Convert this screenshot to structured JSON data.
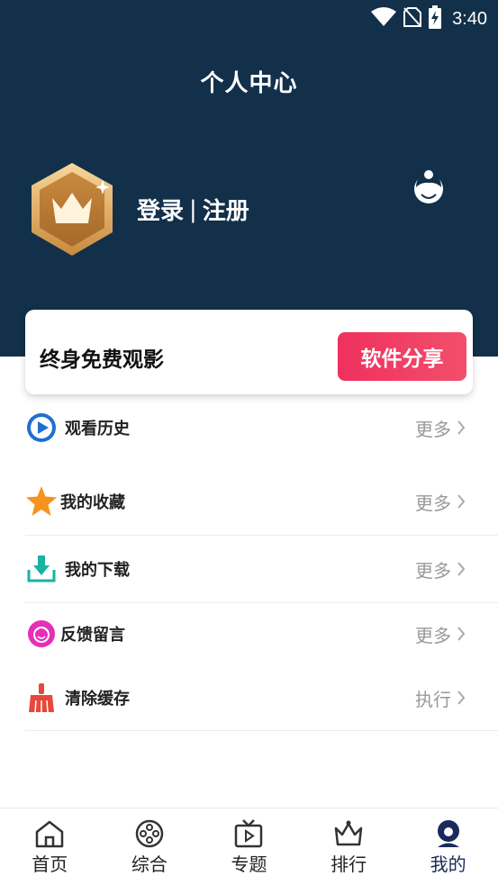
{
  "status_bar": {
    "time": "3:40",
    "icons": [
      "wifi-icon",
      "no-sim-icon",
      "battery-charging-icon"
    ]
  },
  "header": {
    "title": "个人中心",
    "login_label": "登录",
    "separator": "|",
    "register_label": "注册",
    "avatar_icon": "crown-badge-icon",
    "service_icon": "customer-service-icon",
    "background_color": "#12304a"
  },
  "promo": {
    "text": "终身免费观影",
    "button_label": "软件分享",
    "button_color": "#f0305e"
  },
  "menu": {
    "items": [
      {
        "label": "观看历史",
        "action": "更多",
        "icon": "play-history-icon"
      },
      {
        "label": "我的收藏",
        "action": "更多",
        "icon": "star-icon"
      },
      {
        "label": "我的下载",
        "action": "更多",
        "icon": "download-icon"
      },
      {
        "label": "反馈留言",
        "action": "更多",
        "icon": "feedback-icon"
      },
      {
        "label": "清除缓存",
        "action": "执行",
        "icon": "broom-icon"
      }
    ]
  },
  "bottom_nav": {
    "items": [
      {
        "label": "首页",
        "icon": "home-icon"
      },
      {
        "label": "综合",
        "icon": "film-reel-icon"
      },
      {
        "label": "专题",
        "icon": "tv-icon"
      },
      {
        "label": "排行",
        "icon": "crown-icon"
      },
      {
        "label": "我的",
        "icon": "profile-icon"
      }
    ],
    "active_index": 4,
    "active_color": "#1a2a5a"
  }
}
